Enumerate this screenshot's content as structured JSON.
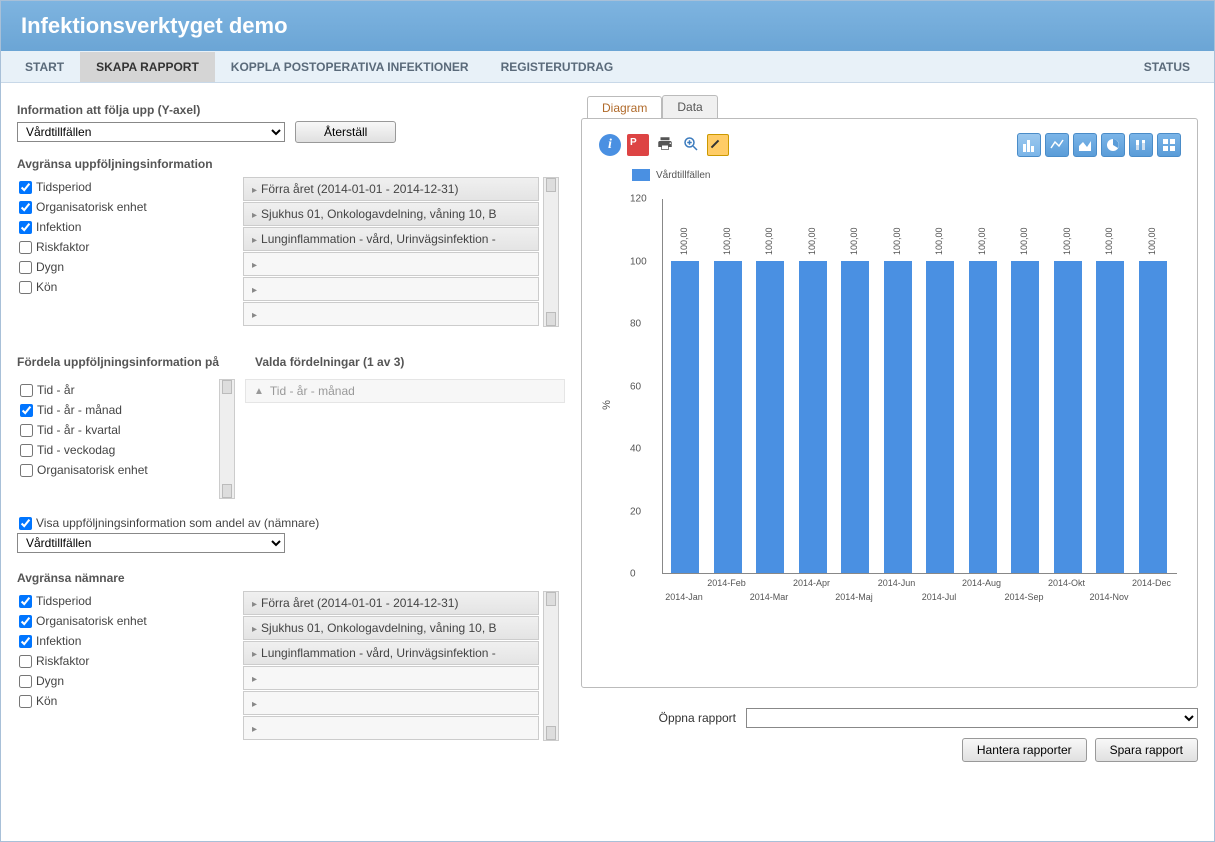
{
  "header": {
    "title": "Infektionsverktyget demo"
  },
  "nav": {
    "start": "START",
    "skapa": "SKAPA RAPPORT",
    "koppla": "KOPPLA POSTOPERATIVA INFEKTIONER",
    "register": "REGISTERUTDRAG",
    "status": "STATUS"
  },
  "left": {
    "info_label": "Information att följa upp (Y-axel)",
    "info_select": "Vårdtillfällen",
    "reset_btn": "Återställ",
    "limit_label": "Avgränsa uppföljningsinformation",
    "checks1": [
      {
        "label": "Tidsperiod",
        "checked": true
      },
      {
        "label": "Organisatorisk enhet",
        "checked": true
      },
      {
        "label": "Infektion",
        "checked": true
      },
      {
        "label": "Riskfaktor",
        "checked": false
      },
      {
        "label": "Dygn",
        "checked": false
      },
      {
        "label": "Kön",
        "checked": false
      }
    ],
    "vals1": [
      "Förra året (2014-01-01 - 2014-12-31)",
      "Sjukhus 01, Onkologavdelning, våning 10, B",
      "Lunginflammation - vård, Urinvägsinfektion -",
      "",
      "",
      ""
    ],
    "dist_label": "Fördela uppföljningsinformation på",
    "sel_dist_label": "Valda fördelningar (1 av 3)",
    "dist_checks": [
      {
        "label": "Tid - år",
        "checked": false
      },
      {
        "label": "Tid - år - månad",
        "checked": true
      },
      {
        "label": "Tid - år - kvartal",
        "checked": false
      },
      {
        "label": "Tid - veckodag",
        "checked": false
      },
      {
        "label": "Organisatorisk enhet",
        "checked": false
      }
    ],
    "sel_dist_item": "Tid - år - månad",
    "prop_check": "Visa uppföljningsinformation som andel av (nämnare)",
    "prop_select": "Vårdtillfällen",
    "denom_label": "Avgränsa nämnare",
    "checks2": [
      {
        "label": "Tidsperiod",
        "checked": true
      },
      {
        "label": "Organisatorisk enhet",
        "checked": true
      },
      {
        "label": "Infektion",
        "checked": true
      },
      {
        "label": "Riskfaktor",
        "checked": false
      },
      {
        "label": "Dygn",
        "checked": false
      },
      {
        "label": "Kön",
        "checked": false
      }
    ],
    "vals2": [
      "Förra året (2014-01-01 - 2014-12-31)",
      "Sjukhus 01, Onkologavdelning, våning 10, B",
      "Lunginflammation - vård, Urinvägsinfektion -",
      "",
      "",
      ""
    ]
  },
  "right": {
    "tab_diagram": "Diagram",
    "tab_data": "Data",
    "legend": "Vårdtillfällen",
    "ylabel": "%",
    "open_label": "Öppna rapport",
    "manage_btn": "Hantera rapporter",
    "save_btn": "Spara rapport"
  },
  "chart_data": {
    "type": "bar",
    "categories": [
      "2014-Jan",
      "2014-Feb",
      "2014-Mar",
      "2014-Apr",
      "2014-Maj",
      "2014-Jun",
      "2014-Jul",
      "2014-Aug",
      "2014-Sep",
      "2014-Okt",
      "2014-Nov",
      "2014-Dec"
    ],
    "values": [
      100.0,
      100.0,
      100.0,
      100.0,
      100.0,
      100.0,
      100.0,
      100.0,
      100.0,
      100.0,
      100.0,
      100.0
    ],
    "value_labels": [
      "100,00",
      "100,00",
      "100,00",
      "100,00",
      "100,00",
      "100,00",
      "100,00",
      "100,00",
      "100,00",
      "100,00",
      "100,00",
      "100,00"
    ],
    "title": "",
    "xlabel": "",
    "ylabel": "%",
    "ylim": [
      0,
      120
    ],
    "yticks": [
      0,
      20,
      40,
      60,
      80,
      100,
      120
    ],
    "legend": [
      "Vårdtillfällen"
    ]
  }
}
